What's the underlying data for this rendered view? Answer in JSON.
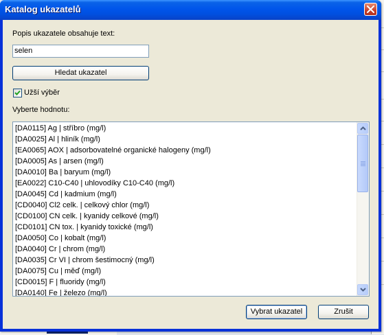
{
  "window": {
    "title": "Katalog ukazatelů",
    "close_icon": "close-icon"
  },
  "search": {
    "label": "Popis ukazatele obsahuje text:",
    "value": "selen",
    "button_label": "Hledat ukazatel"
  },
  "filter": {
    "checkbox_label": "Užší výběr",
    "checked": true
  },
  "list": {
    "label": "Vyberte hodnotu:",
    "items": [
      "[DA0115] Ag | stříbro (mg/l)",
      "[DA0025] Al | hliník (mg/l)",
      "[EA0065] AOX | adsorbovatelné organické halogeny (mg/l)",
      "[DA0005] As | arsen (mg/l)",
      "[DA0010] Ba | baryum (mg/l)",
      "[EA0022] C10-C40 | uhlovodíky C10-C40 (mg/l)",
      "[DA0045] Cd | kadmium (mg/l)",
      "[CD0040] Cl2 celk. | celkový chlor (mg/l)",
      "[CD0100] CN celk. | kyanidy celkové (mg/l)",
      "[CD0101] CN tox. | kyanidy toxické (mg/l)",
      "[DA0050] Co | kobalt (mg/l)",
      "[DA0040] Cr | chrom (mg/l)",
      "[DA0035] Cr VI | chrom šestimocný (mg/l)",
      "[DA0075] Cu | měď (mg/l)",
      "[CD0015] F | fluoridy (mg/l)",
      "[DA0140] Fe | železo (mg/l)"
    ]
  },
  "buttons": {
    "select_label": "Vybrat ukazatel",
    "cancel_label": "Zrušit"
  },
  "colors": {
    "titlebar": "#0055ea",
    "dialog_bg": "#ece9d8",
    "close": "#c8402a"
  }
}
